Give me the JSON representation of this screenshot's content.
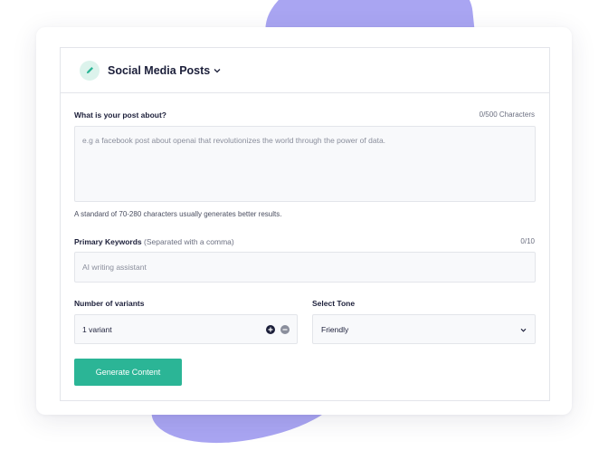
{
  "header": {
    "title": "Social Media Posts",
    "pencil_icon": "pencil-icon",
    "chevron_icon": "chevron-down-icon"
  },
  "post": {
    "label": "What is your post about?",
    "counter": "0/500 Characters",
    "placeholder": "e.g a facebook post about openai that revolutionizes the world through the power of data.",
    "value": "",
    "hint": "A standard of 70-280 characters usually generates better results."
  },
  "keywords": {
    "label": "Primary Keywords",
    "label_note": "(Separated with a comma)",
    "counter": "0/10",
    "placeholder": "AI writing assistant",
    "value": ""
  },
  "variants": {
    "label": "Number of variants",
    "value": "1 variant",
    "plus_icon": "plus-circle-icon",
    "minus_icon": "minus-circle-icon"
  },
  "tone": {
    "label": "Select Tone",
    "selected": "Friendly",
    "chevron_icon": "chevron-down-icon"
  },
  "generate_button": {
    "label": "Generate Content"
  },
  "colors": {
    "accent": "#2bb596",
    "blob": "#a9a5f2",
    "text": "#1c1f3a",
    "border": "#e3e5ea",
    "field_bg": "#f8f9fb"
  }
}
